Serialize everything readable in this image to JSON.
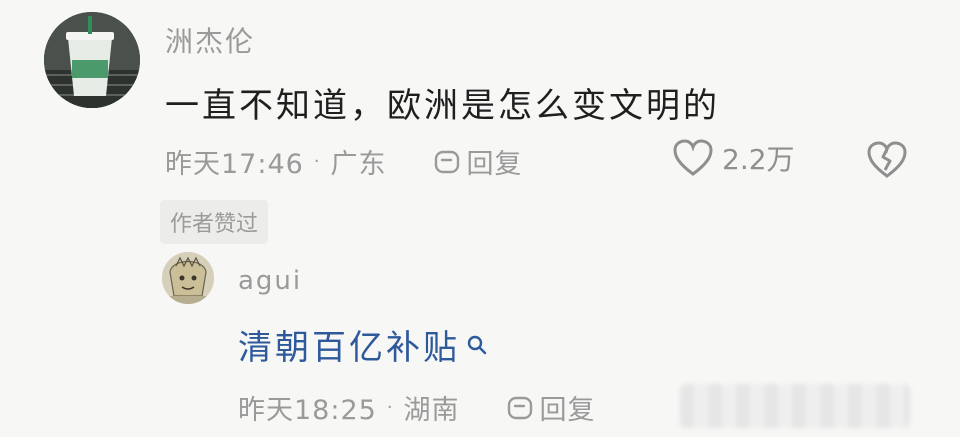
{
  "main_comment": {
    "username": "洲杰伦",
    "text": "一直不知道，欧洲是怎么变文明的",
    "time": "昨天17:46",
    "separator": "·",
    "location": "广东",
    "reply_label": "回复",
    "like_count": "2.2万",
    "author_liked_badge": "作者赞过"
  },
  "reply_comment": {
    "username": "agui",
    "text": "清朝百亿补贴",
    "time": "昨天18:25",
    "separator": "·",
    "location": "湖南",
    "reply_label": "回复"
  },
  "icons": {
    "reply": "reply-icon",
    "like": "heart-icon",
    "dislike": "broken-heart-icon",
    "search": "search-icon"
  },
  "colors": {
    "link_blue": "#2e5a9c",
    "meta_gray": "#9a9a9a",
    "text_dark": "#1f1f1f"
  }
}
